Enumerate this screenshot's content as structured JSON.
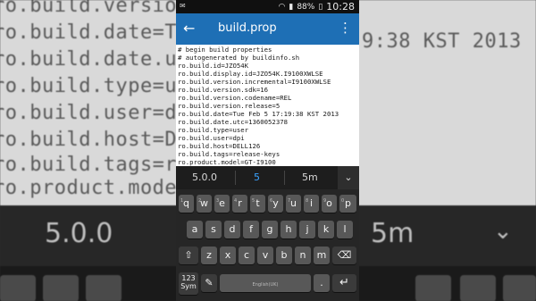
{
  "background": {
    "lines": [
      "ro.build.versio",
      "ro.build.date=T",
      "ro.build.date.u",
      "ro.build.type=u",
      "ro.build.user=d",
      "ro.build.host=D",
      "ro.build.tags=r",
      "ro.product.mode"
    ],
    "date_fragment": "9:38 KST 2013",
    "suggestions": [
      "5.0.0",
      "5",
      "5m"
    ]
  },
  "status_bar": {
    "left_icon": "notification-icon",
    "wifi_icon": "wifi-icon",
    "signal_icon": "signal-icon",
    "battery": "88%",
    "time": "10:28"
  },
  "action_bar": {
    "title": "build.prop",
    "back_icon": "back-arrow-icon",
    "menu_icon": "overflow-menu-icon",
    "color": "#1e6fb5"
  },
  "editor": {
    "lines": [
      "# begin build properties",
      "# autogenerated by buildinfo.sh",
      "ro.build.id=JZO54K",
      "ro.build.display.id=JZO54K.I9100XWLSE",
      "ro.build.version.incremental=I9100XWLSE",
      "ro.build.version.sdk=16",
      "ro.build.version.codename=REL",
      "ro.build.version.release=5",
      "ro.build.date=Tue Feb  5 17:19:38 KST 2013",
      "ro.build.date.utc=1360052378",
      "ro.build.type=user",
      "ro.build.user=dpi",
      "ro.build.host=DELL126",
      "ro.build.tags=release-keys",
      "ro.product.model=GT-I9100"
    ]
  },
  "suggestions": {
    "items": [
      "5.0.0",
      "5",
      "5m"
    ],
    "highlight_color": "#3aa3ff"
  },
  "keyboard": {
    "row1": [
      "q",
      "w",
      "e",
      "r",
      "t",
      "y",
      "u",
      "i",
      "o",
      "p"
    ],
    "row1_nums": [
      "1",
      "2",
      "3",
      "4",
      "5",
      "6",
      "7",
      "8",
      "9",
      "0"
    ],
    "row2": [
      "a",
      "s",
      "d",
      "f",
      "g",
      "h",
      "j",
      "k",
      "l"
    ],
    "row3": [
      "z",
      "x",
      "c",
      "v",
      "b",
      "n",
      "m"
    ],
    "shift": "⇧",
    "delete": "⌫",
    "sym_label": "123\nSym",
    "handwriting": "✎",
    "space_label": "English(UK)",
    "period": ".",
    "enter": "↵"
  }
}
